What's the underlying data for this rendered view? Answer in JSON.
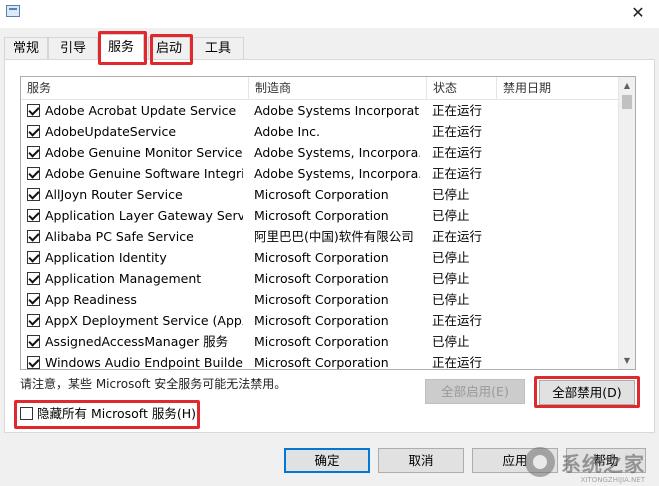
{
  "window": {
    "close_symbol": "✕"
  },
  "tabs": [
    {
      "label": "常规"
    },
    {
      "label": "引导"
    },
    {
      "label": "服务"
    },
    {
      "label": "启动"
    },
    {
      "label": "工具"
    }
  ],
  "table": {
    "columns": [
      "服务",
      "制造商",
      "状态",
      "禁用日期"
    ],
    "rows": [
      {
        "name": "Adobe Acrobat Update Service",
        "manufacturer": "Adobe Systems Incorporat...",
        "status": "正在运行",
        "date": ""
      },
      {
        "name": "AdobeUpdateService",
        "manufacturer": "Adobe Inc.",
        "status": "正在运行",
        "date": ""
      },
      {
        "name": "Adobe Genuine Monitor Service",
        "manufacturer": "Adobe Systems, Incorpora...",
        "status": "正在运行",
        "date": ""
      },
      {
        "name": "Adobe Genuine Software Integrit...",
        "manufacturer": "Adobe Systems, Incorpora...",
        "status": "正在运行",
        "date": ""
      },
      {
        "name": "AllJoyn Router Service",
        "manufacturer": "Microsoft Corporation",
        "status": "已停止",
        "date": ""
      },
      {
        "name": "Application Layer Gateway Service",
        "manufacturer": "Microsoft Corporation",
        "status": "已停止",
        "date": ""
      },
      {
        "name": "Alibaba PC Safe Service",
        "manufacturer": "阿里巴巴(中国)软件有限公司",
        "status": "正在运行",
        "date": ""
      },
      {
        "name": "Application Identity",
        "manufacturer": "Microsoft Corporation",
        "status": "已停止",
        "date": ""
      },
      {
        "name": "Application Management",
        "manufacturer": "Microsoft Corporation",
        "status": "已停止",
        "date": ""
      },
      {
        "name": "App Readiness",
        "manufacturer": "Microsoft Corporation",
        "status": "已停止",
        "date": ""
      },
      {
        "name": "AppX Deployment Service (AppX...",
        "manufacturer": "Microsoft Corporation",
        "status": "正在运行",
        "date": ""
      },
      {
        "name": "AssignedAccessManager 服务",
        "manufacturer": "Microsoft Corporation",
        "status": "已停止",
        "date": ""
      },
      {
        "name": "Windows Audio Endpoint Builder",
        "manufacturer": "Microsoft Corporation",
        "status": "正在运行",
        "date": ""
      }
    ]
  },
  "scrollbar": {
    "up_symbol": "▲",
    "down_symbol": "▼"
  },
  "notice": "请注意，某些 Microsoft 安全服务可能无法禁用。",
  "buttons": {
    "enable_all": "全部启用(E)",
    "disable_all": "全部禁用(D)",
    "ok": "确定",
    "cancel": "取消",
    "apply": "应用",
    "help": "帮助"
  },
  "hide_ms_label": "隐藏所有 Microsoft 服务(H)",
  "watermark": {
    "text": "系统之家",
    "url": "XITONGZHIJIA.NET"
  },
  "colors": {
    "highlight": "#e0282e",
    "focus": "#0078d7"
  }
}
